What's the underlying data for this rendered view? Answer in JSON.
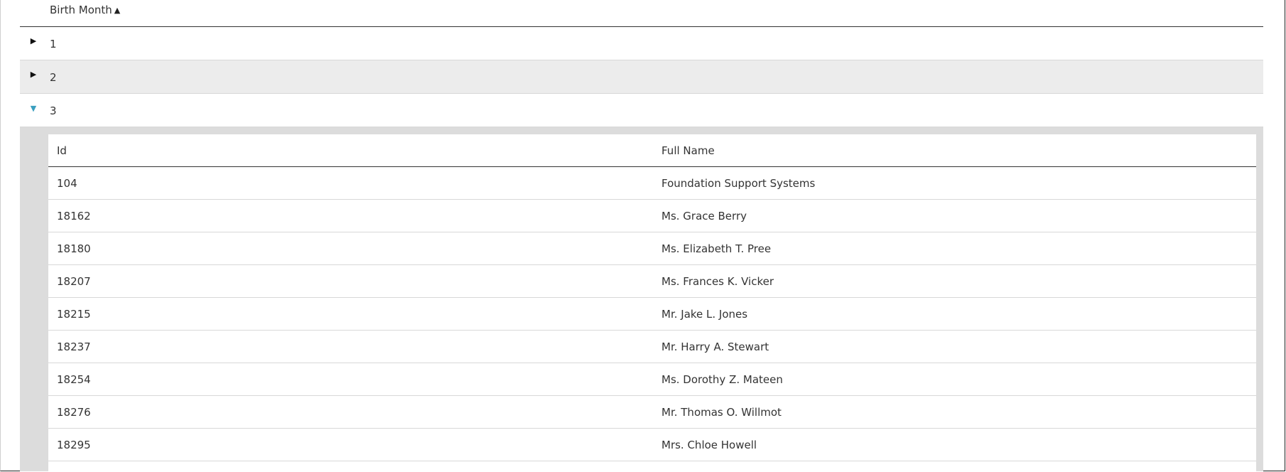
{
  "grid": {
    "header": {
      "birth_month_label": "Birth Month",
      "sort_icon": "sort-ascending-icon"
    },
    "groups": [
      {
        "label": "1",
        "expanded": false
      },
      {
        "label": "2",
        "expanded": false
      },
      {
        "label": "3",
        "expanded": true
      }
    ],
    "detail": {
      "columns": {
        "id": "Id",
        "full_name": "Full Name"
      },
      "rows": [
        {
          "id": "104",
          "full_name": "Foundation Support Systems"
        },
        {
          "id": "18162",
          "full_name": "Ms. Grace Berry"
        },
        {
          "id": "18180",
          "full_name": "Ms. Elizabeth T. Pree"
        },
        {
          "id": "18207",
          "full_name": "Ms. Frances K. Vicker"
        },
        {
          "id": "18215",
          "full_name": "Mr. Jake L. Jones"
        },
        {
          "id": "18237",
          "full_name": "Mr. Harry A. Stewart"
        },
        {
          "id": "18254",
          "full_name": "Ms. Dorothy Z. Mateen"
        },
        {
          "id": "18276",
          "full_name": "Mr. Thomas O. Willmot"
        },
        {
          "id": "18295",
          "full_name": "Mrs. Chloe Howell"
        }
      ]
    }
  },
  "colors": {
    "expander_open": "#3a9fbf",
    "alt_row": "#ececec",
    "detail_bg": "#dcdcdc"
  }
}
